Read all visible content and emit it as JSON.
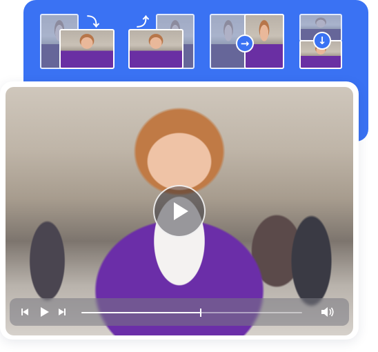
{
  "transitions": {
    "items": [
      {
        "name": "slide-right-transition",
        "icon": "curved-arrow-right-icon"
      },
      {
        "name": "slide-left-transition",
        "icon": "curved-arrow-left-icon"
      },
      {
        "name": "push-right-transition",
        "icon": "arrow-right-badge-icon"
      },
      {
        "name": "push-down-transition",
        "icon": "arrow-down-badge-icon"
      }
    ]
  },
  "player": {
    "progress": 0.54,
    "colors": {
      "accent": "#3a72f3",
      "control_bg": "#787882"
    }
  }
}
